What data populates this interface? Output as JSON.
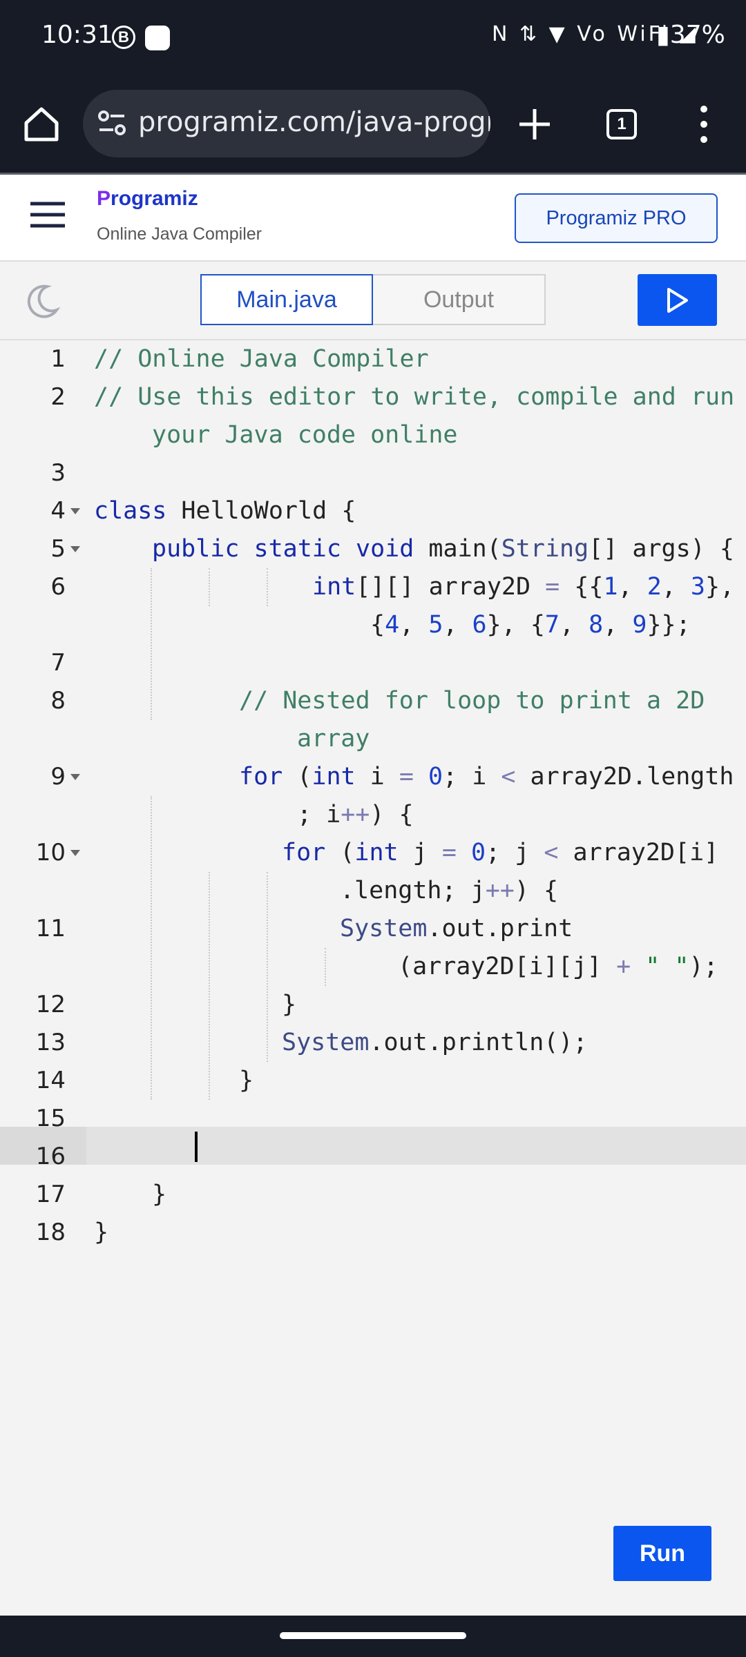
{
  "status_bar": {
    "time": "10:31",
    "badge_letter": "B",
    "signal_icons": "N ⇅ ▼ Vo WiFi ◢",
    "battery": "▮37%"
  },
  "browser": {
    "url": "programiz.com/java-programming/online-compiler/",
    "tab_count": "1"
  },
  "header": {
    "logo_first": "P",
    "logo_rest": "rogramiz",
    "subtitle": "Online Java Compiler",
    "pro_button": "Programiz PRO"
  },
  "toolbar": {
    "tab_main": "Main.java",
    "tab_output": "Output"
  },
  "editor": {
    "line_numbers": [
      "1",
      "2",
      "3",
      "4",
      "5",
      "6",
      "7",
      "8",
      "9",
      "10",
      "11",
      "12",
      "13",
      "14",
      "15",
      "16",
      "17",
      "18"
    ]
  },
  "run_button": "Run",
  "colors": {
    "accent": "#0b56ef",
    "comment": "#3f7f66",
    "keyword": "#1729a7"
  }
}
